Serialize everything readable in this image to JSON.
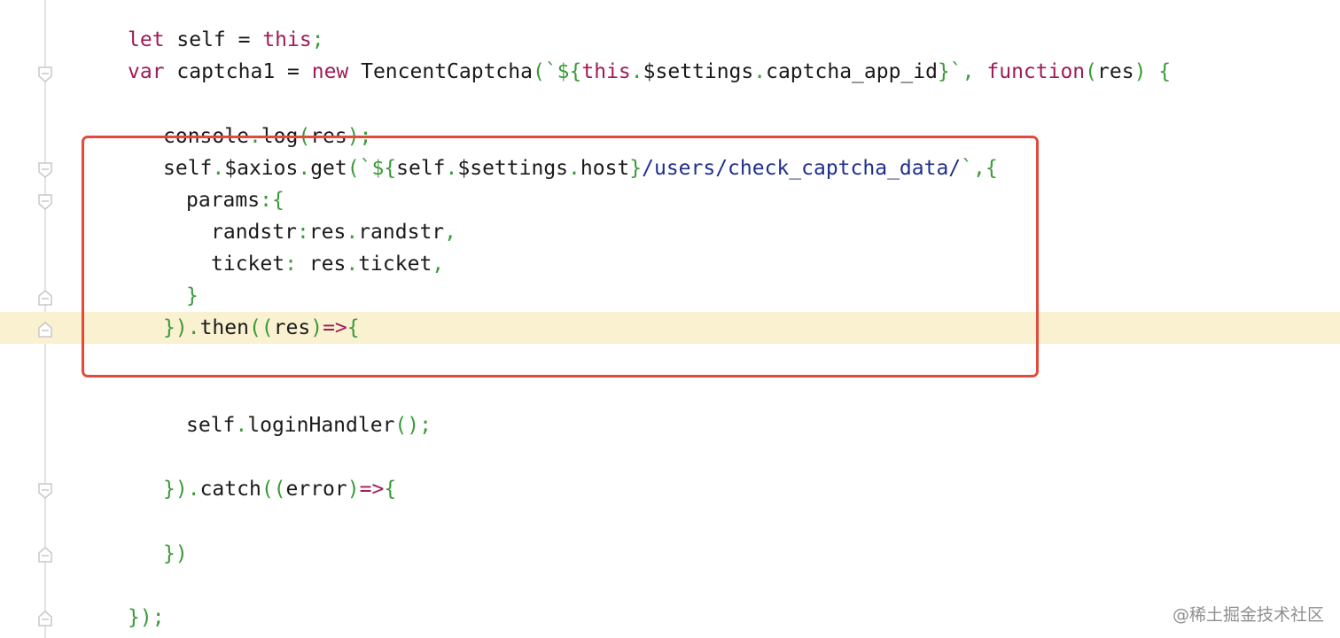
{
  "colors": {
    "keyword": "#a01c56",
    "punctuation": "#3a9a3a",
    "string": "#1f2f8c",
    "text": "#1a1a1a",
    "highlight_row": "#f9f1cf",
    "selection_border": "#e24b3a"
  },
  "code": {
    "line1": {
      "kw_let": "let",
      "self_eq": " self = ",
      "kw_this": "this",
      "semi": ";"
    },
    "line2": {
      "kw_var": "var",
      "captcha_eq": " captcha1 = ",
      "kw_new": "new",
      "tencent": " TencentCaptcha",
      "open_tpl": "(`${",
      "kw_this": "this",
      "dot1": ".",
      "settings": "$settings",
      "dot2": ".",
      "app_id": "captcha_app_id",
      "close_tpl": "}`, ",
      "kw_function": "function",
      "args_open": "(",
      "res": "res",
      "args_close": ") {"
    },
    "line3": {
      "console": "console",
      "dot": ".",
      "log": "log",
      "paren_open": "(",
      "res": "res",
      "paren_close": ");"
    },
    "line4": {
      "self": "self",
      "dot1": ".",
      "axios": "$axios",
      "dot2": ".",
      "get": "get",
      "open_tpl": "(`${",
      "self2": "self",
      "dot3": ".",
      "settings": "$settings",
      "dot4": ".",
      "host": "host",
      "close_brace": "}",
      "path": "/users/check_captcha_data/",
      "tail": "`,{"
    },
    "line5": {
      "params": "params",
      "colon_brace": ":{"
    },
    "line6": {
      "randstr_key": "randstr",
      "colon": ":",
      "res": "res",
      "dot": ".",
      "randstr": "randstr",
      "comma": ","
    },
    "line7": {
      "ticket_key": "ticket",
      "colon": ": ",
      "res": "res",
      "dot": ".",
      "ticket": "ticket",
      "comma": ","
    },
    "line8": {
      "close": "}"
    },
    "line9": {
      "close": "})",
      "dot": ".",
      "then": "then",
      "open": "((",
      "res": "res",
      "arrow_open": ")",
      "arrow": "=>",
      "brace": "{"
    },
    "line10": {
      "self": "self",
      "dot": ".",
      "login": "loginHandler",
      "call": "();"
    },
    "line11": {
      "close": "})",
      "dot": ".",
      "catch": "catch",
      "open": "((",
      "error": "error",
      "arrow_open": ")",
      "arrow": "=>",
      "brace": "{"
    },
    "line12": {
      "close": "})"
    },
    "line13": {
      "close": "});"
    }
  },
  "watermark": "@稀土掘金技术社区"
}
